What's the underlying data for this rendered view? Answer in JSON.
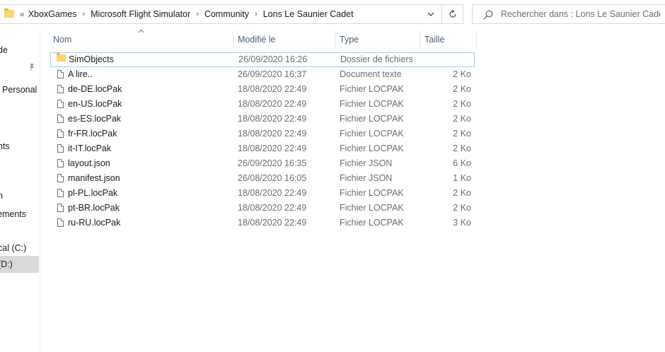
{
  "address_bar": {
    "overflow": "«",
    "crumbs": [
      "XboxGames",
      "Microsoft Flight Simulator",
      "Community",
      "Lons Le Saunier Cadet"
    ],
    "separator": "›"
  },
  "search": {
    "placeholder": "Rechercher dans : Lons Le Saunier Cadet"
  },
  "nav": {
    "items": [
      {
        "label": "de"
      },
      {
        "label": "Personal"
      },
      {
        "label": "nts"
      },
      {
        "label": "n"
      },
      {
        "label": "ements"
      },
      {
        "label": "cal (C:)"
      },
      {
        "label": "(D:)"
      }
    ]
  },
  "columns": {
    "name": "Nom",
    "modified": "Modifié le",
    "type": "Type",
    "size": "Taille"
  },
  "files": [
    {
      "name": "SimObjects",
      "modified": "26/09/2020 16:26",
      "type": "Dossier de fichiers",
      "size": "",
      "kind": "folder"
    },
    {
      "name": "A lire..",
      "modified": "26/09/2020 16:37",
      "type": "Document texte",
      "size": "2 Ko",
      "kind": "file"
    },
    {
      "name": "de-DE.locPak",
      "modified": "18/08/2020 22:49",
      "type": "Fichier LOCPAK",
      "size": "2 Ko",
      "kind": "file"
    },
    {
      "name": "en-US.locPak",
      "modified": "18/08/2020 22:49",
      "type": "Fichier LOCPAK",
      "size": "2 Ko",
      "kind": "file"
    },
    {
      "name": "es-ES.locPak",
      "modified": "18/08/2020 22:49",
      "type": "Fichier LOCPAK",
      "size": "2 Ko",
      "kind": "file"
    },
    {
      "name": "fr-FR.locPak",
      "modified": "18/08/2020 22:49",
      "type": "Fichier LOCPAK",
      "size": "2 Ko",
      "kind": "file"
    },
    {
      "name": "it-IT.locPak",
      "modified": "18/08/2020 22:49",
      "type": "Fichier LOCPAK",
      "size": "2 Ko",
      "kind": "file"
    },
    {
      "name": "layout.json",
      "modified": "26/09/2020 16:35",
      "type": "Fichier JSON",
      "size": "6 Ko",
      "kind": "file"
    },
    {
      "name": "manifest.json",
      "modified": "26/08/2020 16:05",
      "type": "Fichier JSON",
      "size": "1 Ko",
      "kind": "file"
    },
    {
      "name": "pl-PL.locPak",
      "modified": "18/08/2020 22:49",
      "type": "Fichier LOCPAK",
      "size": "2 Ko",
      "kind": "file"
    },
    {
      "name": "pt-BR.locPak",
      "modified": "18/08/2020 22:49",
      "type": "Fichier LOCPAK",
      "size": "2 Ko",
      "kind": "file"
    },
    {
      "name": "ru-RU.locPak",
      "modified": "18/08/2020 22:49",
      "type": "Fichier LOCPAK",
      "size": "3 Ko",
      "kind": "file"
    }
  ],
  "colors": {
    "selection_border": "#99d1ff",
    "header_text": "#4c607a",
    "folder": "#f8d775"
  }
}
